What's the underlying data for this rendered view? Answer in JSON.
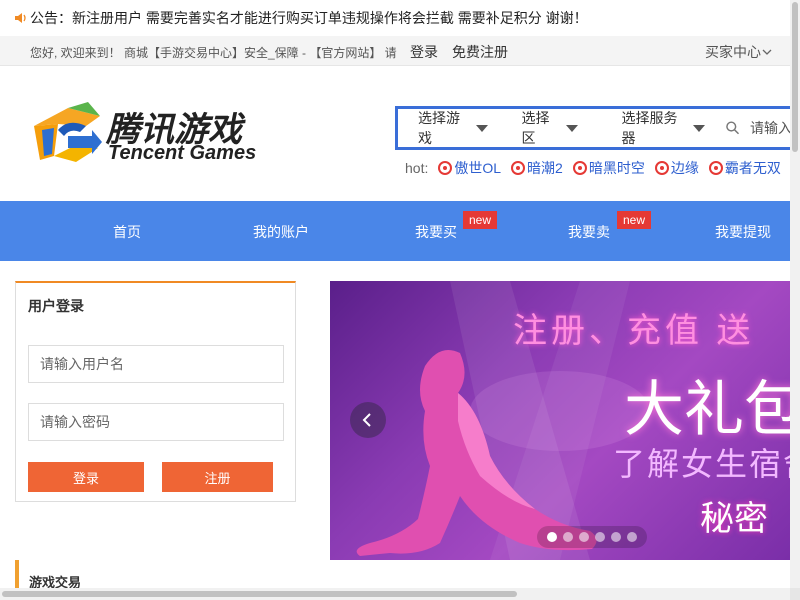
{
  "notice": {
    "text": "公告：新注册用户 需要完善实名才能进行购买订单违规操作将会拦截 需要补足积分 谢谢！"
  },
  "topbar": {
    "greeting": "您好, 欢迎来到！ 商城【手游交易中心】安全_保障 - 【官方网站】 请",
    "login": "登录",
    "register": "免费注册",
    "buyer_center": "买家中心"
  },
  "logo": {
    "cn": "腾讯游戏",
    "en": "Tencent Games"
  },
  "search": {
    "select_game": "选择游戏",
    "select_zone": "选择区",
    "select_server": "选择服务器",
    "placeholder": "请输入"
  },
  "hot": {
    "label": "hot:",
    "tags": [
      "傲世OL",
      "暗潮2",
      "暗黑时空",
      "边缘",
      "霸者无双"
    ]
  },
  "nav": {
    "items": [
      "首页",
      "我的账户",
      "我要买",
      "我要卖",
      "我要提现"
    ],
    "badge": "new"
  },
  "login_panel": {
    "title": "用户登录",
    "username_placeholder": "请输入用户名",
    "password_placeholder": "请输入密码",
    "login_button": "登录",
    "register_button": "注册"
  },
  "banner": {
    "line1": "注册、充值 送",
    "line2": "大礼包",
    "line3": "了解女生宿舍",
    "line4": "秘密",
    "active_slide": 1,
    "slide_count": 6
  },
  "section": {
    "title": "游戏交易"
  },
  "colors": {
    "nav": "#4a86e8",
    "accent": "#ef6535",
    "badge": "#e53935",
    "link": "#2e5fcf"
  }
}
